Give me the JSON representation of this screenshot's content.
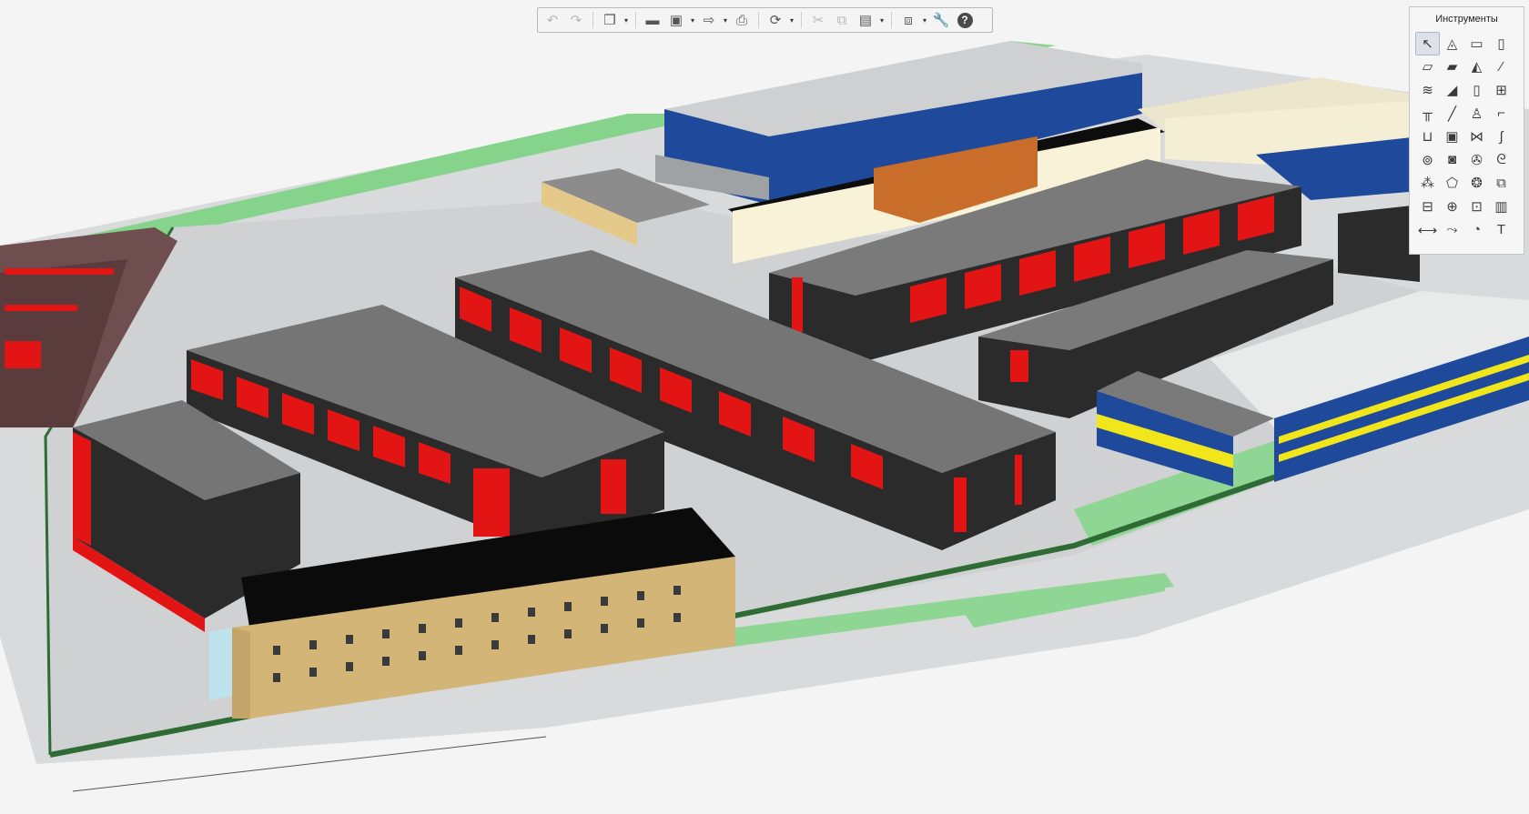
{
  "toolbar": {
    "buttons": [
      {
        "name": "undo",
        "icon": "undo-icon",
        "glyph": "↶",
        "disabled": true
      },
      {
        "name": "redo",
        "icon": "redo-icon",
        "glyph": "↷",
        "disabled": true
      },
      {
        "name": "view-3d",
        "icon": "cube-icon",
        "glyph": "❒",
        "dropdown": true
      },
      {
        "name": "open",
        "icon": "folder-icon",
        "glyph": "▬"
      },
      {
        "name": "save",
        "icon": "floppy-disk-icon",
        "glyph": "▣",
        "dropdown": true
      },
      {
        "name": "export",
        "icon": "export-icon",
        "glyph": "⇨",
        "dropdown": true
      },
      {
        "name": "print",
        "icon": "printer-icon",
        "glyph": "⎙"
      },
      {
        "name": "navigation",
        "icon": "orbit-icon",
        "glyph": "⟳",
        "dropdown": true
      },
      {
        "name": "cut",
        "icon": "scissors-icon",
        "glyph": "✂",
        "disabled": true
      },
      {
        "name": "copy",
        "icon": "copy-icon",
        "glyph": "⧉",
        "disabled": true
      },
      {
        "name": "paste",
        "icon": "clipboard-icon",
        "glyph": "▤",
        "dropdown": true
      },
      {
        "name": "layers",
        "icon": "layers-icon",
        "glyph": "⧈",
        "dropdown": true
      },
      {
        "name": "settings",
        "icon": "wrench-icon",
        "glyph": "🔧"
      },
      {
        "name": "help",
        "icon": "help-icon",
        "glyph": "?"
      }
    ]
  },
  "tools_panel": {
    "title": "Инструменты",
    "tools": [
      {
        "name": "select",
        "icon": "cursor-arrow-icon",
        "glyph": "↖",
        "active": true
      },
      {
        "name": "shapes",
        "icon": "shapes-icon",
        "glyph": "◬"
      },
      {
        "name": "wall",
        "icon": "wall-icon",
        "glyph": "▭"
      },
      {
        "name": "column",
        "icon": "column-icon",
        "glyph": "▯"
      },
      {
        "name": "slab",
        "icon": "slab-icon",
        "glyph": "▱"
      },
      {
        "name": "floor-opening",
        "icon": "floor-opening-icon",
        "glyph": "▰"
      },
      {
        "name": "roof",
        "icon": "roof-icon",
        "glyph": "◭"
      },
      {
        "name": "beam",
        "icon": "beam-icon",
        "glyph": "⁄"
      },
      {
        "name": "stair",
        "icon": "stair-icon",
        "glyph": "≋"
      },
      {
        "name": "ramp",
        "icon": "ramp-icon",
        "glyph": "◢"
      },
      {
        "name": "door",
        "icon": "door-icon",
        "glyph": "▯"
      },
      {
        "name": "window",
        "icon": "window-icon",
        "glyph": "⊞"
      },
      {
        "name": "railing",
        "icon": "railing-icon",
        "glyph": "╥"
      },
      {
        "name": "line",
        "icon": "line-icon",
        "glyph": "╱"
      },
      {
        "name": "equipment",
        "icon": "equipment-icon",
        "glyph": "♙"
      },
      {
        "name": "pipe",
        "icon": "pipe-icon",
        "glyph": "⌐"
      },
      {
        "name": "sink",
        "icon": "sink-icon",
        "glyph": "⊔"
      },
      {
        "name": "appliance",
        "icon": "appliance-icon",
        "glyph": "▣"
      },
      {
        "name": "valve",
        "icon": "valve-icon",
        "glyph": "⋈"
      },
      {
        "name": "fitting",
        "icon": "fitting-icon",
        "glyph": "∫"
      },
      {
        "name": "pump",
        "icon": "pump-icon",
        "glyph": "⊚"
      },
      {
        "name": "boiler",
        "icon": "boiler-icon",
        "glyph": "◙"
      },
      {
        "name": "fan",
        "icon": "fan-icon",
        "glyph": "✇"
      },
      {
        "name": "duct",
        "icon": "duct-icon",
        "glyph": "ᘓ"
      },
      {
        "name": "sprinkler",
        "icon": "sprinkler-icon",
        "glyph": "⁂"
      },
      {
        "name": "room",
        "icon": "room-icon",
        "glyph": "⬠"
      },
      {
        "name": "diffuser",
        "icon": "diffuser-icon",
        "glyph": "❂"
      },
      {
        "name": "box",
        "icon": "box-icon",
        "glyph": "⧉"
      },
      {
        "name": "panel",
        "icon": "electrical-panel-icon",
        "glyph": "⊟"
      },
      {
        "name": "light",
        "icon": "light-fixture-icon",
        "glyph": "⊕"
      },
      {
        "name": "socket",
        "icon": "socket-icon",
        "glyph": "⊡"
      },
      {
        "name": "cabinet",
        "icon": "cabinet-icon",
        "glyph": "▥"
      },
      {
        "name": "dimension",
        "icon": "dimension-icon",
        "glyph": "⟷"
      },
      {
        "name": "section",
        "icon": "section-cut-icon",
        "glyph": "⤳"
      },
      {
        "name": "detail",
        "icon": "detail-icon",
        "glyph": "◔"
      },
      {
        "name": "text",
        "icon": "text-tool-icon",
        "glyph": "T"
      }
    ]
  },
  "colors": {
    "background": "#f2f3f2",
    "lawn": "#86d38b",
    "roof_gray": "#757575",
    "wall_dark": "#2b2b2b",
    "accent_red": "#e31414",
    "facade_blue": "#1f4a9c",
    "facade_beige": "#d2b577",
    "stripe_yellow": "#f1e61c"
  }
}
